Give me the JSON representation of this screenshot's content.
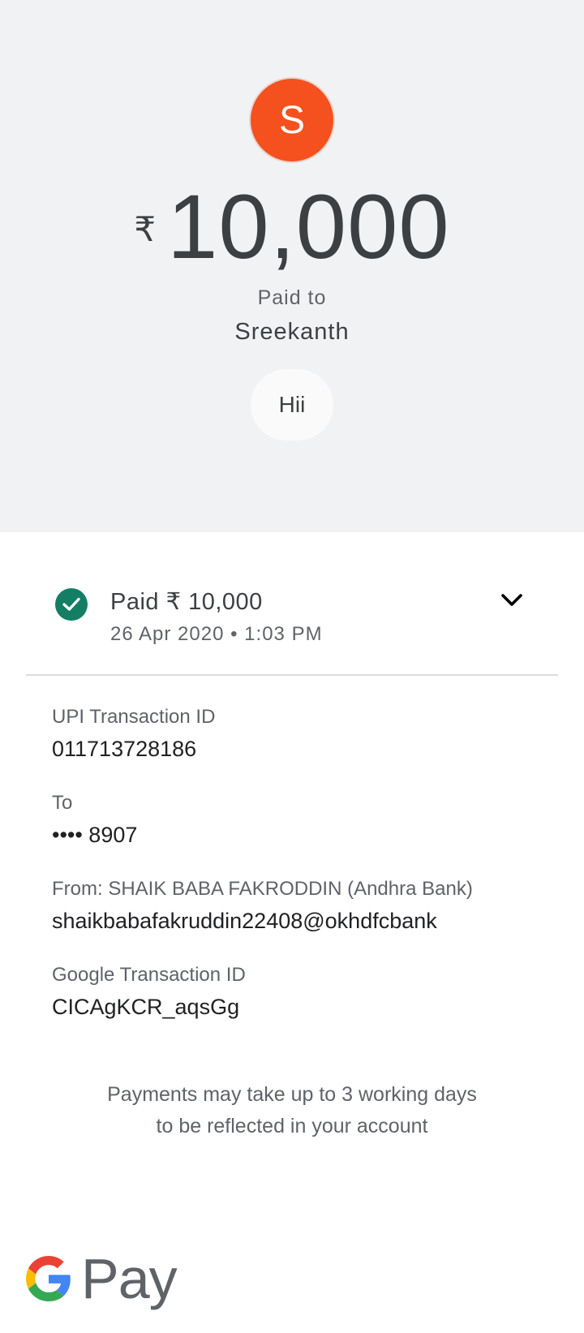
{
  "header": {
    "avatar_initial": "S",
    "avatar_color": "#f4511e",
    "currency_symbol": "₹",
    "amount": "10,000",
    "paid_to_label": "Paid to",
    "payee_name": "Sreekanth",
    "note": "Hii"
  },
  "status": {
    "icon": "check-circle-icon",
    "status_color": "#137e63",
    "title": "Paid ₹ 10,000",
    "datetime": "26 Apr 2020 • 1:03 PM",
    "expand_icon": "chevron-down-icon"
  },
  "details": [
    {
      "label": "UPI Transaction ID",
      "value": "011713728186"
    },
    {
      "label": "To",
      "value": "•••• 8907"
    },
    {
      "label": "From: SHAIK BABA FAKRODDIN (Andhra Bank)",
      "value": "shaikbabafakruddin22408@okhdfcbank"
    },
    {
      "label": "Google Transaction ID",
      "value": "CICAgKCR_aqsGg"
    }
  ],
  "footer": {
    "note_line1": "Payments may take up to 3 working days",
    "note_line2": "to be reflected in your account",
    "brand_word": "Pay",
    "brand_logo_icon": "google-g-icon"
  }
}
